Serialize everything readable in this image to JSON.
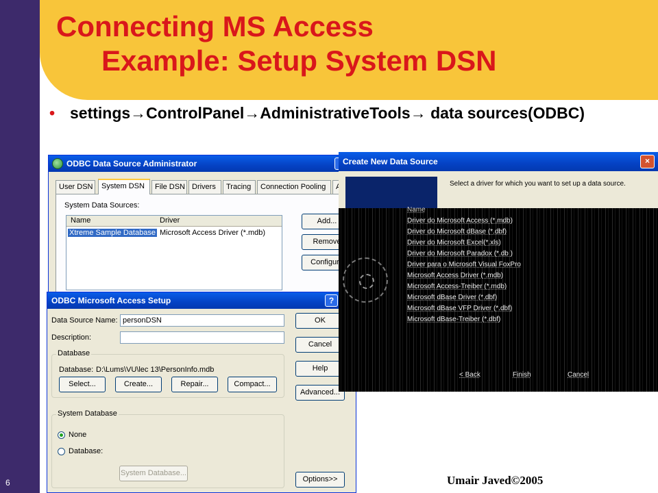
{
  "slide": {
    "title_line1": "Connecting MS Access",
    "title_line2": "Example: Setup System DSN",
    "bullet_symbol": "•",
    "bullet_text": "settings→ControlPanel→AdministrativeTools→ data sources(ODBC)",
    "slide_number": "6",
    "footer": "Umair Javed©2005",
    "colors": {
      "title": "#d9171b",
      "header_band": "#f8c53a",
      "left_bar": "#3d2a6b"
    }
  },
  "odbc_admin": {
    "title": "ODBC Data Source Administrator",
    "help_button": "?",
    "tabs": [
      "User DSN",
      "System DSN",
      "File DSN",
      "Drivers",
      "Tracing",
      "Connection Pooling",
      "Abo"
    ],
    "active_tab": "System DSN",
    "section_label": "System Data Sources:",
    "columns": [
      "Name",
      "Driver"
    ],
    "rows": [
      {
        "name": "Xtreme Sample Database",
        "driver": "Microsoft Access Driver (*.mdb)"
      }
    ],
    "buttons": {
      "add": "Add...",
      "remove": "Remove",
      "configure": "Configure"
    }
  },
  "access_setup": {
    "title": "ODBC Microsoft Access Setup",
    "help_button": "?",
    "data_source_name_label": "Data Source Name:",
    "data_source_name_value": "personDSN",
    "description_label": "Description:",
    "description_value": "",
    "database_group": "Database",
    "database_path_label": "Database:",
    "database_path": "D:\\Lums\\VU\\lec 13\\PersonInfo.mdb",
    "db_buttons": {
      "select": "Select...",
      "create": "Create...",
      "repair": "Repair...",
      "compact": "Compact..."
    },
    "system_db_group": "System Database",
    "radio_none": "None",
    "radio_database": "Database:",
    "system_db_button": "System Database...",
    "side_buttons": {
      "ok": "OK",
      "cancel": "Cancel",
      "help": "Help",
      "advanced": "Advanced...",
      "options": "Options>>"
    }
  },
  "create_new_ds": {
    "title": "Create New Data Source",
    "close_icon": "×",
    "prompt": "Select a driver for which you want to set up a data source.",
    "list_header": "Name",
    "drivers": [
      "Driver do Microsoft Access (*.mdb)",
      "Driver do Microsoft dBase (*.dbf)",
      "Driver do Microsoft Excel(*.xls)",
      "Driver do Microsoft Paradox (*.db )",
      "Driver para o Microsoft Visual FoxPro",
      "Microsoft Access Driver (*.mdb)",
      "Microsoft Access-Treiber (*.mdb)",
      "Microsoft dBase Driver (*.dbf)",
      "Microsoft dBase VFP Driver (*.dbf)",
      "Microsoft dBase-Treiber (*.dbf)"
    ],
    "buttons": {
      "back": "< Back",
      "finish": "Finish",
      "cancel": "Cancel"
    }
  }
}
